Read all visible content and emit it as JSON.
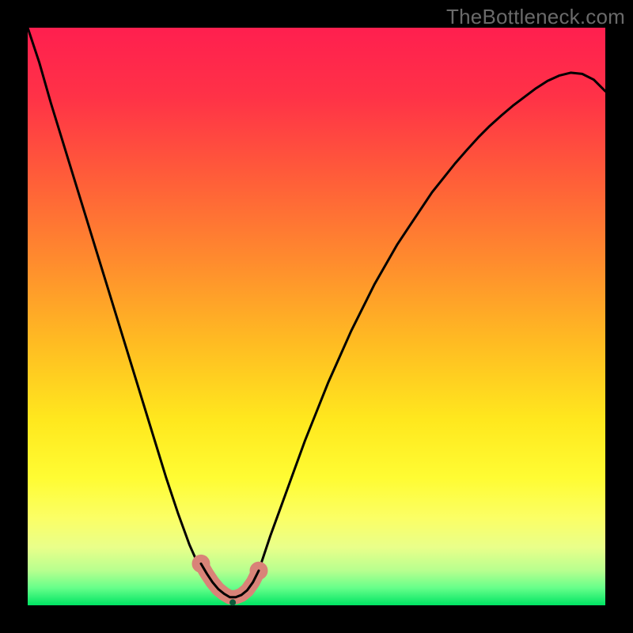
{
  "watermark": "TheBottleneck.com",
  "gradient": {
    "stops": [
      {
        "offset": 0.0,
        "color": "#ff1f4f"
      },
      {
        "offset": 0.12,
        "color": "#ff3247"
      },
      {
        "offset": 0.25,
        "color": "#ff5a3a"
      },
      {
        "offset": 0.4,
        "color": "#ff8a2e"
      },
      {
        "offset": 0.55,
        "color": "#ffbd22"
      },
      {
        "offset": 0.68,
        "color": "#ffe81e"
      },
      {
        "offset": 0.78,
        "color": "#fffc33"
      },
      {
        "offset": 0.85,
        "color": "#fbff66"
      },
      {
        "offset": 0.9,
        "color": "#e9ff8a"
      },
      {
        "offset": 0.94,
        "color": "#b7ff8f"
      },
      {
        "offset": 0.97,
        "color": "#66ff8a"
      },
      {
        "offset": 1.0,
        "color": "#00e463"
      }
    ]
  },
  "chart_data": {
    "type": "line",
    "title": "",
    "xlabel": "",
    "ylabel": "",
    "xlim": [
      0,
      1
    ],
    "ylim": [
      0,
      1
    ],
    "x": [
      0.0,
      0.02,
      0.04,
      0.06,
      0.08,
      0.1,
      0.12,
      0.14,
      0.16,
      0.18,
      0.2,
      0.22,
      0.24,
      0.26,
      0.28,
      0.3,
      0.31,
      0.32,
      0.33,
      0.34,
      0.35,
      0.36,
      0.37,
      0.38,
      0.39,
      0.4,
      0.42,
      0.44,
      0.46,
      0.48,
      0.5,
      0.52,
      0.54,
      0.56,
      0.58,
      0.6,
      0.62,
      0.64,
      0.66,
      0.68,
      0.7,
      0.72,
      0.74,
      0.76,
      0.78,
      0.8,
      0.82,
      0.84,
      0.86,
      0.88,
      0.9,
      0.92,
      0.94,
      0.96,
      0.98,
      1.0
    ],
    "values": [
      1.0,
      0.94,
      0.87,
      0.805,
      0.74,
      0.675,
      0.61,
      0.545,
      0.48,
      0.415,
      0.35,
      0.285,
      0.22,
      0.16,
      0.105,
      0.06,
      0.045,
      0.03,
      0.018,
      0.01,
      0.005,
      0.005,
      0.01,
      0.02,
      0.035,
      0.06,
      0.12,
      0.175,
      0.23,
      0.285,
      0.335,
      0.385,
      0.43,
      0.475,
      0.515,
      0.555,
      0.59,
      0.625,
      0.655,
      0.685,
      0.715,
      0.74,
      0.765,
      0.788,
      0.81,
      0.83,
      0.848,
      0.865,
      0.88,
      0.895,
      0.908,
      0.917,
      0.922,
      0.92,
      0.91,
      0.89
    ],
    "minimum_x": 0.355,
    "minimum_y": 0.005,
    "marker_points_x": [
      0.3,
      0.31,
      0.32,
      0.33,
      0.34,
      0.35,
      0.36,
      0.37,
      0.38,
      0.39,
      0.4
    ],
    "marker_points_y": [
      0.072,
      0.055,
      0.04,
      0.028,
      0.02,
      0.014,
      0.014,
      0.018,
      0.026,
      0.04,
      0.06
    ]
  }
}
